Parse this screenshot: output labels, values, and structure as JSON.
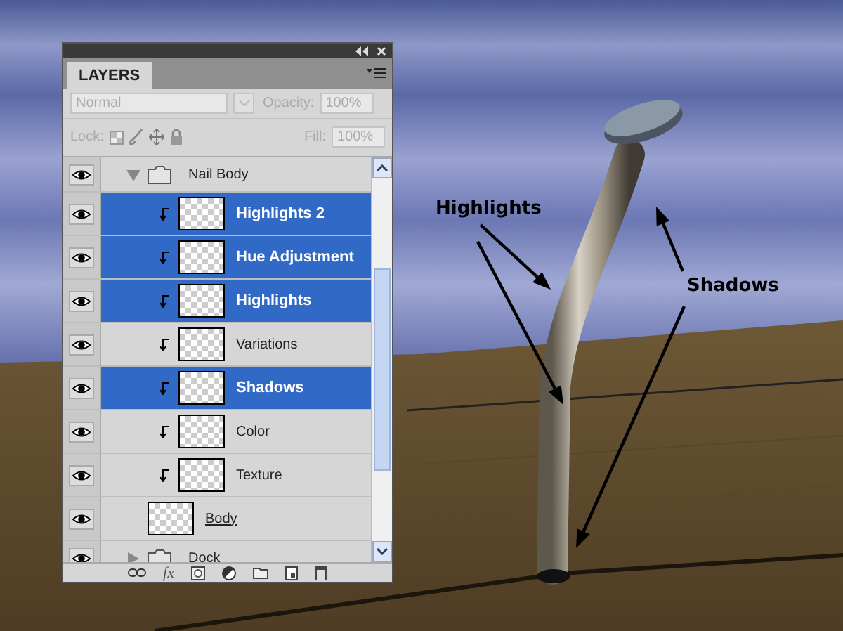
{
  "panel": {
    "tab": "LAYERS",
    "blend_mode": {
      "value": "Normal",
      "disabled": true
    },
    "opacity": {
      "label": "Opacity:",
      "value": "100%",
      "disabled": true
    },
    "lock_label": "Lock:",
    "fill": {
      "label": "Fill:",
      "value": "100%",
      "disabled": true
    },
    "effects_label": "fx"
  },
  "layers": [
    {
      "kind": "group",
      "name": "Nail Body",
      "visible": true,
      "expanded": true,
      "selected": false,
      "children": [
        {
          "kind": "layer",
          "name": "Highlights 2",
          "visible": true,
          "clipped": true,
          "selected": true
        },
        {
          "kind": "layer",
          "name": "Hue Adjustment",
          "visible": true,
          "clipped": true,
          "selected": true
        },
        {
          "kind": "layer",
          "name": "Highlights",
          "visible": true,
          "clipped": true,
          "selected": true
        },
        {
          "kind": "layer",
          "name": "Variations",
          "visible": true,
          "clipped": true,
          "selected": false
        },
        {
          "kind": "layer",
          "name": "Shadows",
          "visible": true,
          "clipped": true,
          "selected": true
        },
        {
          "kind": "layer",
          "name": "Color",
          "visible": true,
          "clipped": true,
          "selected": false
        },
        {
          "kind": "layer",
          "name": "Texture",
          "visible": true,
          "clipped": true,
          "selected": false
        },
        {
          "kind": "layer",
          "name": "Body",
          "visible": true,
          "clipped": false,
          "selected": false
        }
      ]
    },
    {
      "kind": "group",
      "name": "Dock",
      "visible": true,
      "expanded": false,
      "selected": false
    }
  ],
  "annotations": [
    {
      "label": "Highlights"
    },
    {
      "label": "Shadows"
    }
  ]
}
